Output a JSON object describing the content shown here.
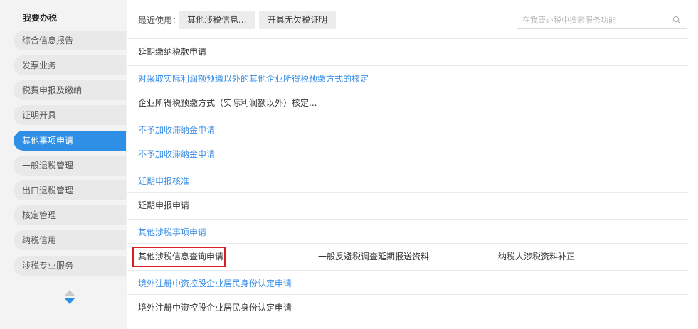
{
  "sidebar": {
    "title": "我要办税",
    "items": [
      {
        "label": "综合信息报告"
      },
      {
        "label": "发票业务"
      },
      {
        "label": "税费申报及缴纳"
      },
      {
        "label": "证明开具"
      },
      {
        "label": "其他事项申请",
        "active": true
      },
      {
        "label": "一般退税管理"
      },
      {
        "label": "出口退税管理"
      },
      {
        "label": "核定管理"
      },
      {
        "label": "纳税信用"
      },
      {
        "label": "涉税专业服务"
      }
    ],
    "scroll_up_icon": "caret-up-icon",
    "scroll_down_icon": "caret-down-icon"
  },
  "header": {
    "recent_label": "最近使用：",
    "recent_items": [
      "其他涉税信息...",
      "开具无欠税证明"
    ],
    "search": {
      "placeholder": "在我要办税中搜索服务功能",
      "value": "",
      "icon": "search-icon"
    }
  },
  "content": {
    "rows": [
      {
        "type": "plain",
        "text": "延期缴纳税款申请"
      },
      {
        "type": "link",
        "text": "对采取实际利润额预缴以外的其他企业所得税预缴方式的核定"
      },
      {
        "type": "plain",
        "text": "企业所得税预缴方式（实际利润额以外）核定..."
      },
      {
        "type": "link",
        "text": "不予加收滞纳金申请"
      },
      {
        "type": "link",
        "text": "不予加收滞纳金申请"
      },
      {
        "type": "link",
        "text": "延期申报核准"
      },
      {
        "type": "plain",
        "text": "延期申报申请"
      },
      {
        "type": "link",
        "text": "其他涉税事项申请"
      },
      {
        "type": "plain-multi",
        "items": [
          "其他涉税信息查询申请",
          "一般反避税调查延期报送资料",
          "纳税人涉税资料补正"
        ],
        "highlighted_index": 0
      },
      {
        "type": "link",
        "text": "境外注册中资控股企业居民身份认定申请"
      },
      {
        "type": "plain",
        "text": "境外注册中资控股企业居民身份认定申请"
      }
    ]
  },
  "colors": {
    "accent": "#2f8fe6",
    "link": "#3a8ee6",
    "highlight": "#d81e1e",
    "sidebar_bg": "#f3f3f3"
  }
}
